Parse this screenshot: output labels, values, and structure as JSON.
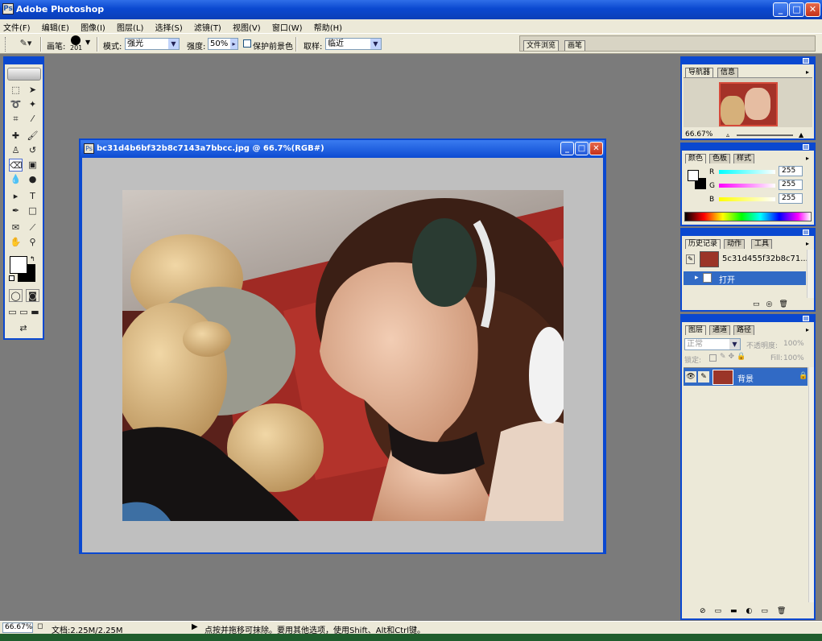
{
  "app": {
    "title": "Adobe Photoshop",
    "icon": "photoshop-icon"
  },
  "menu": [
    "文件(F)",
    "编辑(E)",
    "图像(I)",
    "图层(L)",
    "选择(S)",
    "滤镜(T)",
    "视图(V)",
    "窗口(W)",
    "帮助(H)"
  ],
  "options": {
    "brush_label": "画笔:",
    "brush_size": "201",
    "mode_label": "模式:",
    "mode_value": "强光",
    "strength_label": "强度:",
    "strength_value": "50%",
    "protect_label": "保护前景色",
    "sampling_label": "取样:",
    "sampling_value": "临近",
    "well_tabs": [
      "文件浏览",
      "画笔"
    ]
  },
  "document": {
    "title": "bc31d4b6bf32b8c7143a7bbcc.jpg @ 66.7%(RGB#)",
    "photo_subject": "girl-with-teddy-bear-photo"
  },
  "navigator": {
    "tabs": [
      "导航器",
      "信息"
    ],
    "zoom": "66.67%"
  },
  "color": {
    "tabs": [
      "颜色",
      "色板",
      "样式"
    ],
    "channels": [
      {
        "label": "R",
        "value": "255"
      },
      {
        "label": "G",
        "value": "255"
      },
      {
        "label": "B",
        "value": "255"
      }
    ],
    "foreground": "#ffffff",
    "background": "#000000"
  },
  "history": {
    "tabs": [
      "历史记录",
      "动作",
      "工具"
    ],
    "snapshot": "5c31d455f32b8c71...",
    "step": "打开"
  },
  "layers": {
    "tabs": [
      "图层",
      "通道",
      "路径"
    ],
    "blend_mode": "正常",
    "opacity_label": "不透明度:",
    "opacity_value": "100%",
    "lock_label": "锁定:",
    "fill_label": "Fill:",
    "fill_value": "100%",
    "layer_name": "背景"
  },
  "status": {
    "zoom": "66.67%",
    "doc_size": "文档:2.25M/2.25M",
    "hint": "点按并拖移可抹除。要用其他选项，使用Shift、Alt和Ctrl键。"
  }
}
